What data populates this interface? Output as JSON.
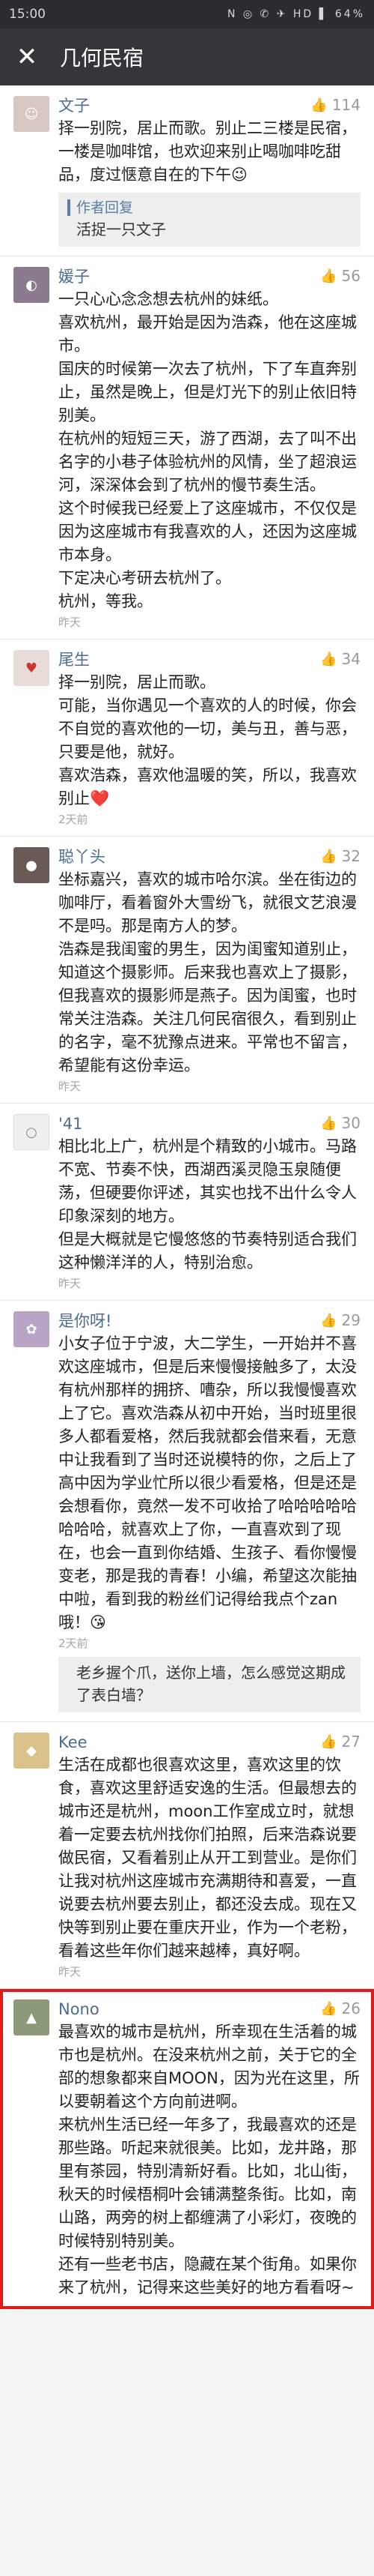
{
  "status": {
    "time": "15:00",
    "icons": "N ◎ ✆ ✈ HD ▌ 64%"
  },
  "nav": {
    "close": "✕",
    "title": "几何民宿"
  },
  "comments": [
    {
      "name": "文子",
      "likes": "114",
      "text": "择一别院，居止而歌。别止二三楼是民宿，一楼是咖啡馆，也欢迎来别止喝咖啡吃甜品，度过惬意自在的下午😉",
      "time": "",
      "reply_label": "作者回复",
      "reply_text": "活捉一只文子",
      "avatar": "#d7c7c1"
    },
    {
      "name": "媛子",
      "likes": "56",
      "text": "一只心心念念想去杭州的妹纸。\n喜欢杭州，最开始是因为浩森，他在这座城市。\n国庆的时候第一次去了杭州，下了车直奔别止，虽然是晚上，但是灯光下的别止依旧特别美。\n在杭州的短短三天，游了西湖，去了叫不出名字的小巷子体验杭州的风情，坐了超浪运河，深深体会到了杭州的慢节奏生活。\n这个时候我已经爱上了这座城市，不仅仅是因为这座城市有我喜欢的人，还因为这座城市本身。\n下定决心考研去杭州了。\n杭州，等我。",
      "time": "昨天",
      "avatar": "#8b7b8e"
    },
    {
      "name": "尾生",
      "likes": "34",
      "text": "择一别院，居止而歌。\n可能，当你遇见一个喜欢的人的时候，你会不自觉的喜欢他的一切，美与丑，善与恶，只要是他，就好。\n喜欢浩森，喜欢他温暖的笑，所以，我喜欢别止❤️",
      "time": "2天前",
      "avatar": "#e8dcd8"
    },
    {
      "name": "聪丫头",
      "likes": "32",
      "text": "坐标嘉兴，喜欢的城市哈尔滨。坐在街边的咖啡厅，看着窗外大雪纷飞，就很文艺浪漫不是吗。那是南方人的梦。\n浩森是我闺蜜的男生，因为闺蜜知道别止，知道这个摄影师。后来我也喜欢上了摄影，但我喜欢的摄影师是燕子。因为闺蜜，也时常关注浩森。关注几何民宿很久，看到别止的名字，毫不犹豫点进来。平常也不留言，希望能有这份幸运。",
      "time": "昨天",
      "avatar": "#6a5a55"
    },
    {
      "name": "'41",
      "likes": "30",
      "text": "相比北上广，杭州是个精致的小城市。马路不宽、节奏不快，西湖西溪灵隐玉泉随便荡，但硬要你评述，其实也找不出什么令人印象深刻的地方。\n但是大概就是它慢悠悠的节奏特别适合我们这种懒洋洋的人，特别治愈。",
      "time": "昨天",
      "avatar": "#f0f0f0"
    },
    {
      "name": "是你呀!",
      "likes": "29",
      "text": "小女子位于宁波，大二学生，一开始并不喜欢这座城市，但是后来慢慢接触多了，太没有杭州那样的拥挤、嘈杂，所以我慢慢喜欢上了它。喜欢浩森从初中开始，当时班里很多人都看爱格，然后我就都会借来看，无意中让我看到了当时还说模特的你，之后上了高中因为学业忙所以很少看爱格，但是还是会想看你，竟然一发不可收拾了哈哈哈哈哈哈哈哈，就喜欢上了你，一直喜欢到了现在，也会一直到你结婚、生孩子、看你慢慢变老，那是我的青春！小编，希望这次能抽中啦，看到我的粉丝们记得给我点个zan哦！😘",
      "time": "2天前",
      "reply_label": "",
      "reply_text": "老乡握个爪，送你上墙，怎么感觉这期成了表白墙？",
      "avatar": "#b8a4c6"
    },
    {
      "name": "Kee",
      "likes": "27",
      "text": "生活在成都也很喜欢这里，喜欢这里的饮食，喜欢这里舒适安逸的生活。但最想去的城市还是杭州，moon工作室成立时，就想着一定要去杭州找你们拍照，后来浩森说要做民宿，又看着别止从开工到营业。是你们让我对杭州这座城市充满期待和喜爱，一直说要去杭州要去别止，都还没去成。现在又快等到别止要在重庆开业，作为一个老粉，看着这些年你们越来越棒，真好啊。",
      "time": "昨天",
      "avatar": "#d9c38a"
    },
    {
      "name": "Nono",
      "likes": "26",
      "text": "最喜欢的城市是杭州，所幸现在生活着的城市也是杭州。在没来杭州之前，关于它的全部的想象都来自MOON，因为光在这里，所以要朝着这个方向前进啊。\n来杭州生活已经一年多了，我最喜欢的还是那些路。听起来就很美。比如，龙井路，那里有茶园，特别清新好看。比如，北山街，秋天的时候梧桐叶会铺满整条街。比如，南山路，两旁的树上都缠满了小彩灯，夜晚的时候特别特别美。\n还有一些老书店，隐藏在某个街角。如果你来了杭州，记得来这些美好的地方看看呀~",
      "time": "",
      "avatar": "#8c9a7a"
    }
  ]
}
